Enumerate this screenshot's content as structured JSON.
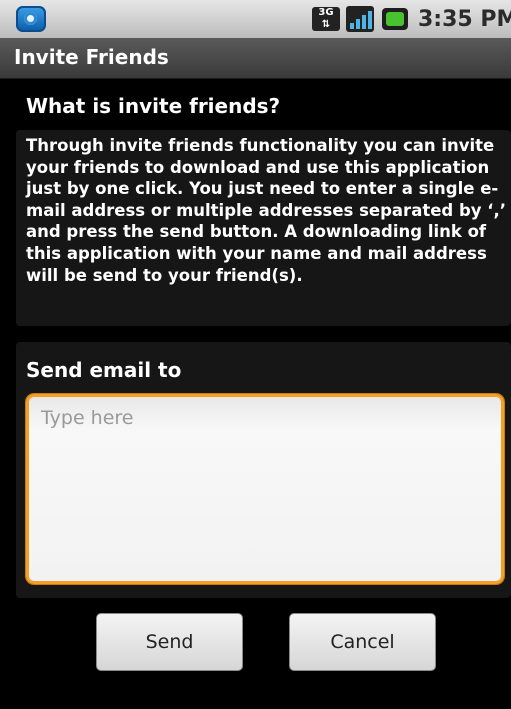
{
  "status_bar": {
    "time": "3:35 PM",
    "network_type": "3G",
    "icons": [
      "app-notification-icon",
      "network-3g-icon",
      "signal-strength-icon",
      "battery-charging-icon"
    ],
    "colors": {
      "background": "#d0d0d0",
      "battery": "#48c22e",
      "signal": "#4fb3e8"
    }
  },
  "title_bar": {
    "title": "Invite Friends"
  },
  "info": {
    "heading": "What is invite friends?",
    "description": "Through invite friends functionality you can invite your friends to download and use this application just by one click. You just need to enter a single e-mail address or multiple addresses separated by ‘,’ and press the send button. A downloading link of this application with your name and mail address will be send to your friend(s)."
  },
  "email_form": {
    "label": "Send email to",
    "placeholder": "Type here",
    "value": "",
    "focus_color": "#f5a024"
  },
  "actions": {
    "send_label": "Send",
    "cancel_label": "Cancel"
  }
}
